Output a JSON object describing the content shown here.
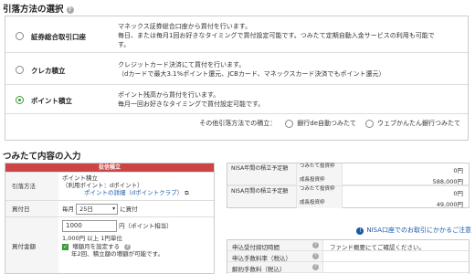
{
  "section1": {
    "title": "引落方法の選択"
  },
  "methods": [
    {
      "label": "証券総合取引口座",
      "desc": "マネックス証券総合口座から買付を行います。\n毎日、または毎月1回お好きなタイミングで買付設定可能です。つみたて定期自動入金サービスの利用も可能です。",
      "selected": false
    },
    {
      "label": "クレカ積立",
      "desc": "クレジットカード決済にて買付を行います。\n（dカードで最大3.1%ポイント還元、JCBカード、マネックスカード決済でもポイント還元）",
      "selected": false
    },
    {
      "label": "ポイント積立",
      "desc": "ポイント残高から買付を行います。\n毎月一回お好きなタイミングで買付設定可能です。",
      "selected": true
    }
  ],
  "other_methods": {
    "prefix": "その他引落方法での積立：",
    "options": [
      "銀行de自動つみたて",
      "ウェブかんたん銀行つみたて"
    ]
  },
  "section2": {
    "title": "つみたて内容の入力"
  },
  "input_panel": {
    "header": "投信積立",
    "method_label": "引落方法",
    "method_value": "ポイント積立",
    "method_sub": "（利用ポイント：dポイント）",
    "method_link": "ポイントの詳細（dポイントクラブ）",
    "date_label": "買付日",
    "date_prefix": "毎月",
    "date_value": "25日",
    "date_suffix": "に買付",
    "amount_label": "買付金額",
    "amount_value": "1000",
    "amount_unit": "円（ポイント相当）",
    "amount_min": "1,000円 以上 1円単位",
    "increase_label": "増額月を設定する",
    "increase_note": "年2回、積立額の増額が可能です。"
  },
  "nisa_table": [
    {
      "main": "NISA年間の積立予定額",
      "sub": "つみたて投資枠",
      "value": "0円"
    },
    {
      "main": "",
      "sub": "成長投資枠",
      "value": "588,000円"
    },
    {
      "main": "NISA月間の積立予定額",
      "sub": "つみたて投資枠",
      "value": "0円"
    },
    {
      "main": "",
      "sub": "成長投資枠",
      "value": "49,000円"
    }
  ],
  "nisa_note": "NISA口座でのお取引にかかるご注意",
  "fee_table": [
    {
      "label": "申込受付締切時間",
      "value": "ファンド概要にてご確認ください。"
    },
    {
      "label": "申込手数料率（税込）",
      "value": ""
    },
    {
      "label": "解約手数料（税込）",
      "value": ""
    }
  ]
}
